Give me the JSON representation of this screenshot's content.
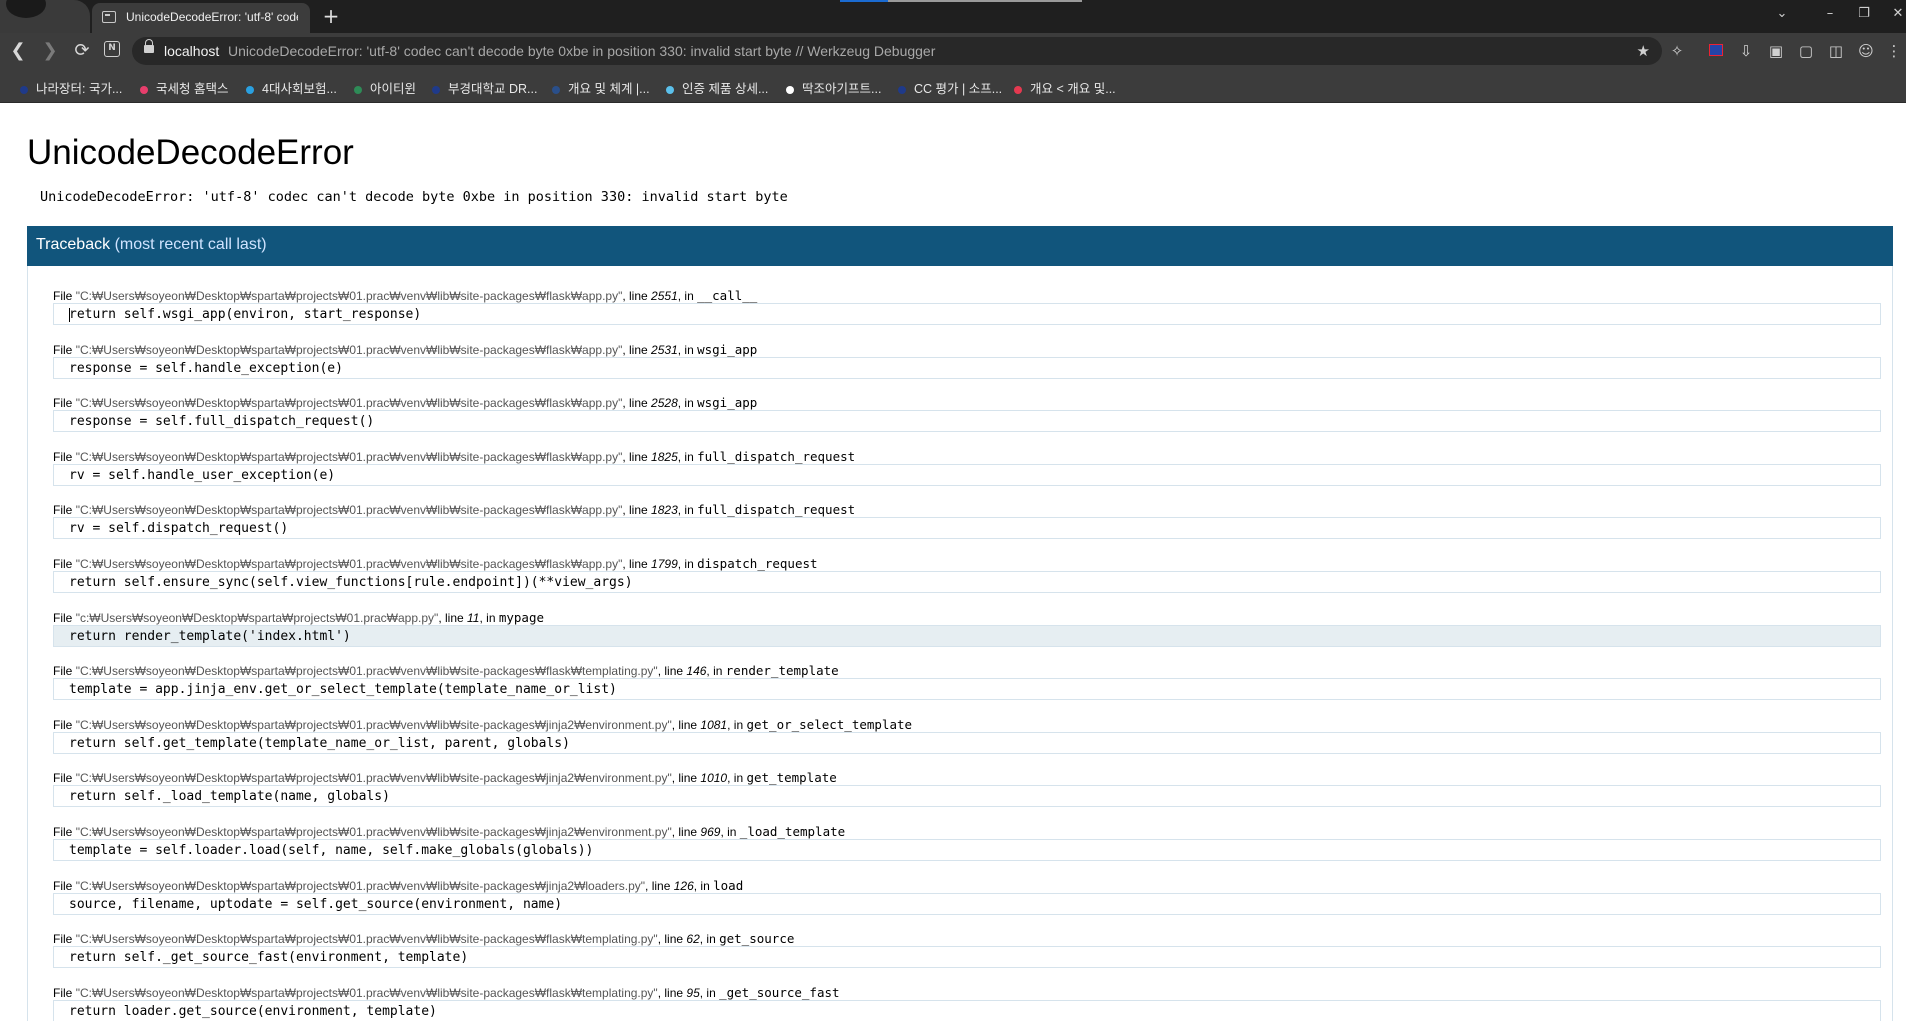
{
  "browser": {
    "tab_title": "UnicodeDecodeError: 'utf-8' codec can't decode byte 0xbe in position 330: invalid start byte // Werkzeug Debugger",
    "new_tab": "+",
    "address": {
      "host": "localhost",
      "rest": "UnicodeDecodeError: 'utf-8' codec can't decode byte 0xbe in position 330: invalid start byte // Werkzeug Debugger"
    },
    "bookmarks": [
      {
        "label": "나라장터: 국가...",
        "color": "#1f3a8a"
      },
      {
        "label": "국세청 홈택스",
        "color": "#e83e6c"
      },
      {
        "label": "4대사회보험...",
        "color": "#2aa0e0"
      },
      {
        "label": "아이티윈",
        "color": "#2e8b57"
      },
      {
        "label": "부경대학교 DR...",
        "color": "#1f3a8a"
      },
      {
        "label": "개요 및 체계 |...",
        "color": "#2a4f8a"
      },
      {
        "label": "인증 제품 상세...",
        "color": "#5bc0eb"
      },
      {
        "label": "딱조아기프트...",
        "color": "#ffffff"
      },
      {
        "label": "CC 평가 | 소프...",
        "color": "#1f3a8a"
      },
      {
        "label": "개요 < 개요 및...",
        "color": "#e53950"
      }
    ]
  },
  "page": {
    "title": "UnicodeDecodeError",
    "message": "UnicodeDecodeError: 'utf-8' codec can't decode byte 0xbe in position 330: invalid start byte",
    "traceback_heading": "Traceback",
    "traceback_subheading": "(most recent call last)",
    "frames": [
      {
        "file": "\"C:₩Users₩soyeon₩Desktop₩sparta₩projects₩01.prac₩venv₩lib₩site-packages₩flask₩app.py\"",
        "line": "2551",
        "func": "__call__",
        "code": "return self.wsgi_app(environ, start_response)"
      },
      {
        "file": "\"C:₩Users₩soyeon₩Desktop₩sparta₩projects₩01.prac₩venv₩lib₩site-packages₩flask₩app.py\"",
        "line": "2531",
        "func": "wsgi_app",
        "code": "response = self.handle_exception(e)"
      },
      {
        "file": "\"C:₩Users₩soyeon₩Desktop₩sparta₩projects₩01.prac₩venv₩lib₩site-packages₩flask₩app.py\"",
        "line": "2528",
        "func": "wsgi_app",
        "code": "response = self.full_dispatch_request()"
      },
      {
        "file": "\"C:₩Users₩soyeon₩Desktop₩sparta₩projects₩01.prac₩venv₩lib₩site-packages₩flask₩app.py\"",
        "line": "1825",
        "func": "full_dispatch_request",
        "code": "rv = self.handle_user_exception(e)"
      },
      {
        "file": "\"C:₩Users₩soyeon₩Desktop₩sparta₩projects₩01.prac₩venv₩lib₩site-packages₩flask₩app.py\"",
        "line": "1823",
        "func": "full_dispatch_request",
        "code": "rv = self.dispatch_request()"
      },
      {
        "file": "\"C:₩Users₩soyeon₩Desktop₩sparta₩projects₩01.prac₩venv₩lib₩site-packages₩flask₩app.py\"",
        "line": "1799",
        "func": "dispatch_request",
        "code": "return self.ensure_sync(self.view_functions[rule.endpoint])(**view_args)"
      },
      {
        "file": "\"c:₩Users₩soyeon₩Desktop₩sparta₩projects₩01.prac₩app.py\"",
        "line": "11",
        "func": "mypage",
        "code": "return render_template('index.html')"
      },
      {
        "file": "\"C:₩Users₩soyeon₩Desktop₩sparta₩projects₩01.prac₩venv₩lib₩site-packages₩flask₩templating.py\"",
        "line": "146",
        "func": "render_template",
        "code": "template = app.jinja_env.get_or_select_template(template_name_or_list)"
      },
      {
        "file": "\"C:₩Users₩soyeon₩Desktop₩sparta₩projects₩01.prac₩venv₩lib₩site-packages₩jinja2₩environment.py\"",
        "line": "1081",
        "func": "get_or_select_template",
        "code": "return self.get_template(template_name_or_list, parent, globals)"
      },
      {
        "file": "\"C:₩Users₩soyeon₩Desktop₩sparta₩projects₩01.prac₩venv₩lib₩site-packages₩jinja2₩environment.py\"",
        "line": "1010",
        "func": "get_template",
        "code": "return self._load_template(name, globals)"
      },
      {
        "file": "\"C:₩Users₩soyeon₩Desktop₩sparta₩projects₩01.prac₩venv₩lib₩site-packages₩jinja2₩environment.py\"",
        "line": "969",
        "func": "_load_template",
        "code": "template = self.loader.load(self, name, self.make_globals(globals))"
      },
      {
        "file": "\"C:₩Users₩soyeon₩Desktop₩sparta₩projects₩01.prac₩venv₩lib₩site-packages₩jinja2₩loaders.py\"",
        "line": "126",
        "func": "load",
        "code": "source, filename, uptodate = self.get_source(environment, name)"
      },
      {
        "file": "\"C:₩Users₩soyeon₩Desktop₩sparta₩projects₩01.prac₩venv₩lib₩site-packages₩flask₩templating.py\"",
        "line": "62",
        "func": "get_source",
        "code": "return self._get_source_fast(environment, template)"
      },
      {
        "file": "\"C:₩Users₩soyeon₩Desktop₩sparta₩projects₩01.prac₩venv₩lib₩site-packages₩flask₩templating.py\"",
        "line": "95",
        "func": "_get_source_fast",
        "code": "return loader.get_source(environment, template)"
      }
    ]
  },
  "labels": {
    "file_prefix": "File",
    "line_prefix": ", line",
    "in_prefix": ", in"
  }
}
